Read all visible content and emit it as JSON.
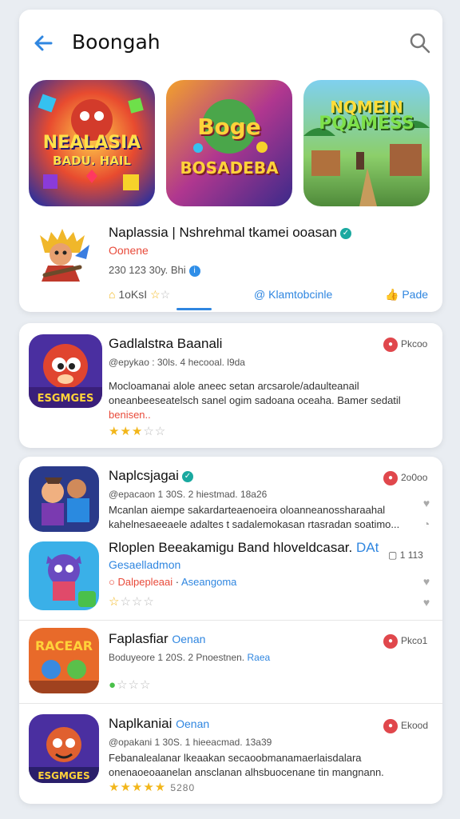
{
  "header": {
    "title": "Boongah"
  },
  "banners": [
    {
      "text_top": "NEALASIA",
      "text_bottom": "BADU. HAIL"
    },
    {
      "text_top": "Boge",
      "text_bottom": "BOSADEBA"
    },
    {
      "text_top": "NQMEIN",
      "text_bottom": "PQAMESS"
    }
  ],
  "featured": {
    "title": "Naplassia | Nshrehmal tkamei ooasan",
    "subtitle": "Oonene",
    "meta": "230 123 30y. Bhi",
    "actions": {
      "rating_label": "1oKsI",
      "community_label": "Klamtobcinle",
      "pade_label": "Pade"
    }
  },
  "apps": [
    {
      "name": "Gadlalstʀa Baanali",
      "meta": "@epykao : 30ls. 4 hecooal. l9da",
      "desc": "Mocloamanai alole aneec setan arcsarole/adaulteanail oneanbeeseatelsch sanel ogim sadoana oceaha. Bamer sedatil",
      "more": "benisen..",
      "badge": "Pkcoo",
      "stars_on": 3
    },
    {
      "name": "Naplcsjagai",
      "meta": "@epacaon 1 30S. 2 hiestmad. 18a26",
      "desc": "Mcanlan aiempe sakardarteaenoeira oloanneanossharaahal kahelnesaeeaele adaltes t sadalemokasan rtasradan soatimo...",
      "badge": "2o0oo",
      "stars_on": 0
    },
    {
      "name": "Rloplen Beeakamigu Band hloveldcasar.",
      "name_tag": "DAt",
      "sub": "Gesaelladmon",
      "alt": "Dalpepleaai",
      "alt2": "Aseangoma",
      "count": "1 113",
      "stars_on": 0
    },
    {
      "name": "Faplasfiar",
      "name_tag": "Oenan",
      "meta": "Boduyeore 1 20S. 2 Pnoestnen.",
      "meta_tag": "Raea",
      "badge": "Pkco1",
      "stars_on": 0
    },
    {
      "name": "Naplkaniai",
      "name_tag": "Oenan",
      "meta": "@opakani 1 30S. 1 hieeacmad. 13a39",
      "desc": "Febanalealanar lkeaakan secaoobmanamaerlaisdalara onenaoeoaanelan ansclanan alhsbuocenane tin mangnann.",
      "score": "5280",
      "badge": "Ekood",
      "stars_on": 5
    }
  ],
  "colors": {
    "accent": "#2f86e0",
    "star": "#f2b61a",
    "badge": "#e0474c"
  }
}
